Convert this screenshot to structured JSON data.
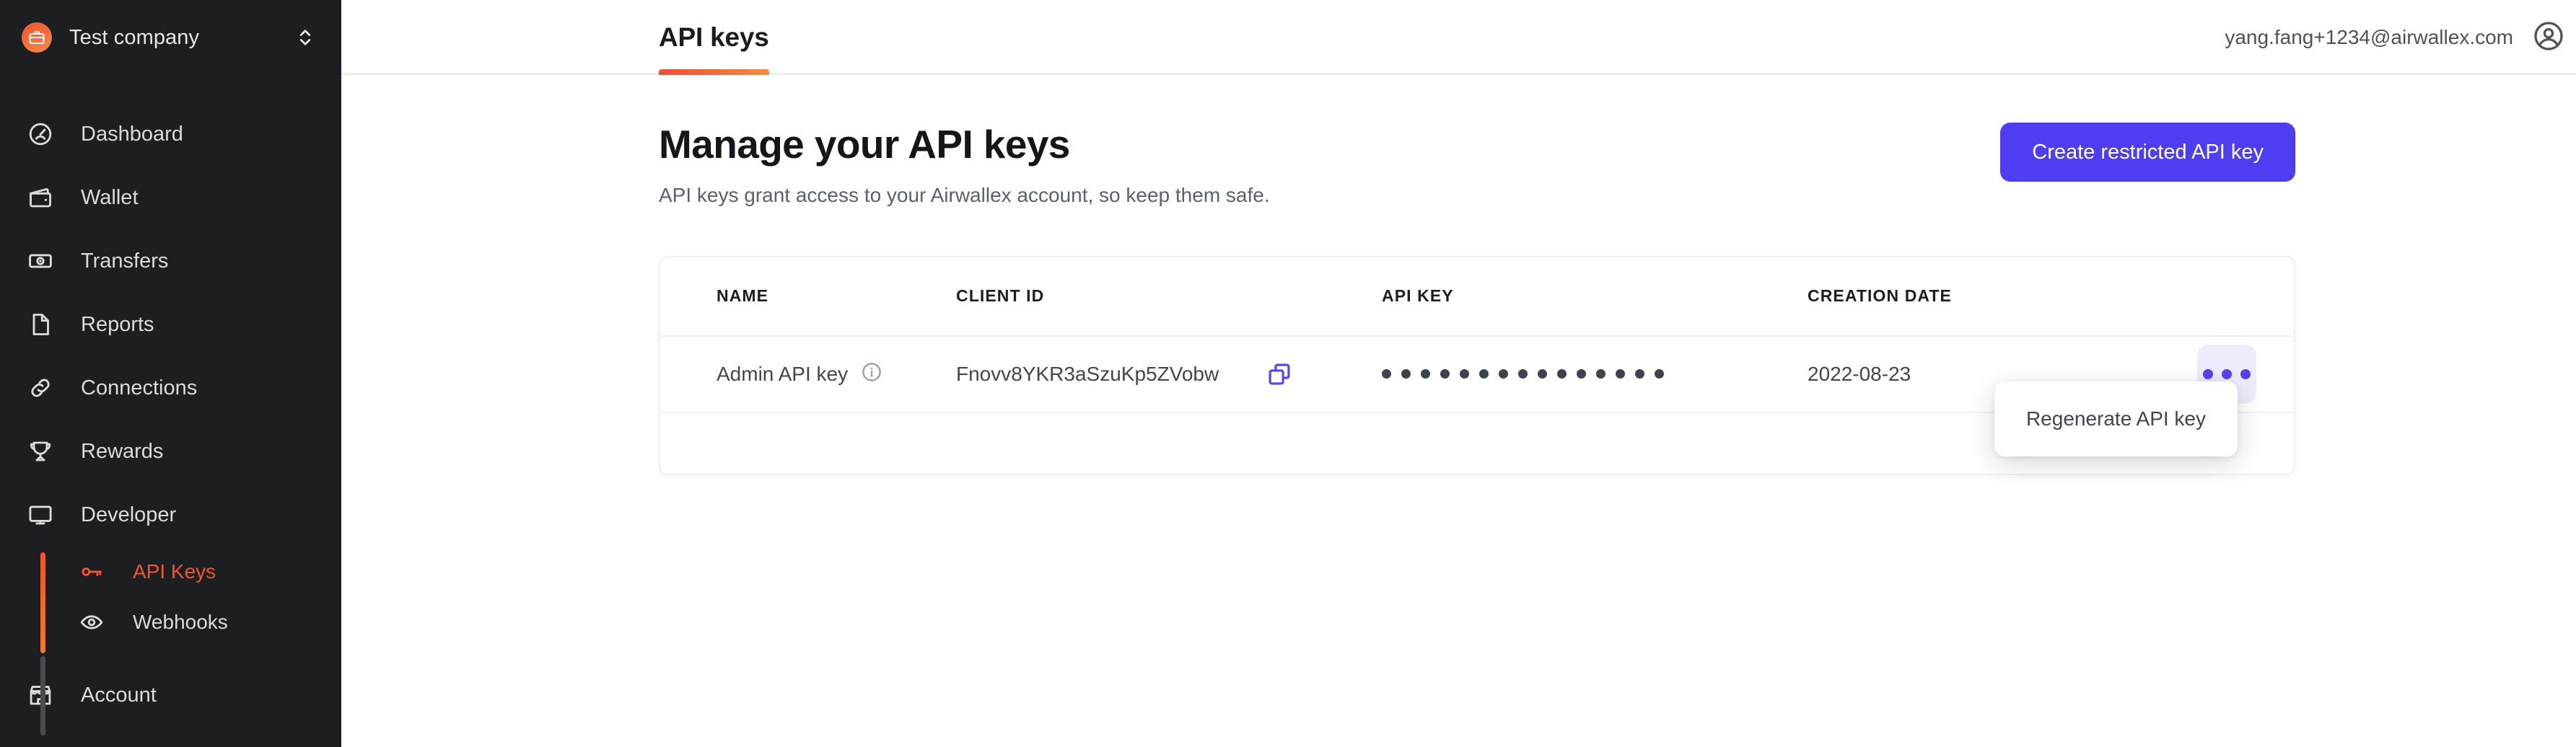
{
  "sidebar": {
    "company": {
      "name": "Test company",
      "avatar_icon": "briefcase-icon",
      "switch_icon": "chevron-up-down-icon"
    },
    "items": [
      {
        "label": "Dashboard",
        "icon": "gauge-icon"
      },
      {
        "label": "Wallet",
        "icon": "wallet-icon"
      },
      {
        "label": "Transfers",
        "icon": "banknote-icon"
      },
      {
        "label": "Reports",
        "icon": "document-icon"
      },
      {
        "label": "Connections",
        "icon": "link-icon"
      },
      {
        "label": "Rewards",
        "icon": "trophy-icon"
      },
      {
        "label": "Developer",
        "icon": "monitor-icon"
      }
    ],
    "subitems": [
      {
        "label": "API Keys",
        "icon": "key-icon",
        "active": true
      },
      {
        "label": "Webhooks",
        "icon": "eye-icon",
        "active": false
      }
    ],
    "account": {
      "label": "Account",
      "icon": "storefront-icon"
    },
    "colors": {
      "background": "#1d1e22",
      "active_accent": "#f2562a",
      "rail_inactive": "#4a4c50"
    }
  },
  "topbar": {
    "tab_label": "API keys",
    "user_email": "yang.fang+1234@airwallex.com",
    "avatar_icon": "user-circle-icon",
    "tab_accent_from": "#ef4d35",
    "tab_accent_to": "#f28b41"
  },
  "page": {
    "title": "Manage your API keys",
    "subtitle": "API keys grant access to your Airwallex account, so keep them safe.",
    "create_button": "Create restricted API key",
    "create_button_color": "#4f3df2"
  },
  "table": {
    "headers": [
      "NAME",
      "CLIENT ID",
      "API KEY",
      "CREATION DATE"
    ],
    "rows": [
      {
        "name": "Admin API key",
        "name_info_icon": "info-icon",
        "client_id": "Fnovv8YKR3aSzuKp5ZVobw",
        "copy_icon": "copy-icon",
        "api_key_masked_count": 15,
        "creation_date": "2022-08-23",
        "actions_icon": "kebab-menu-icon"
      }
    ]
  },
  "dropdown": {
    "items": [
      "Regenerate API key"
    ]
  }
}
